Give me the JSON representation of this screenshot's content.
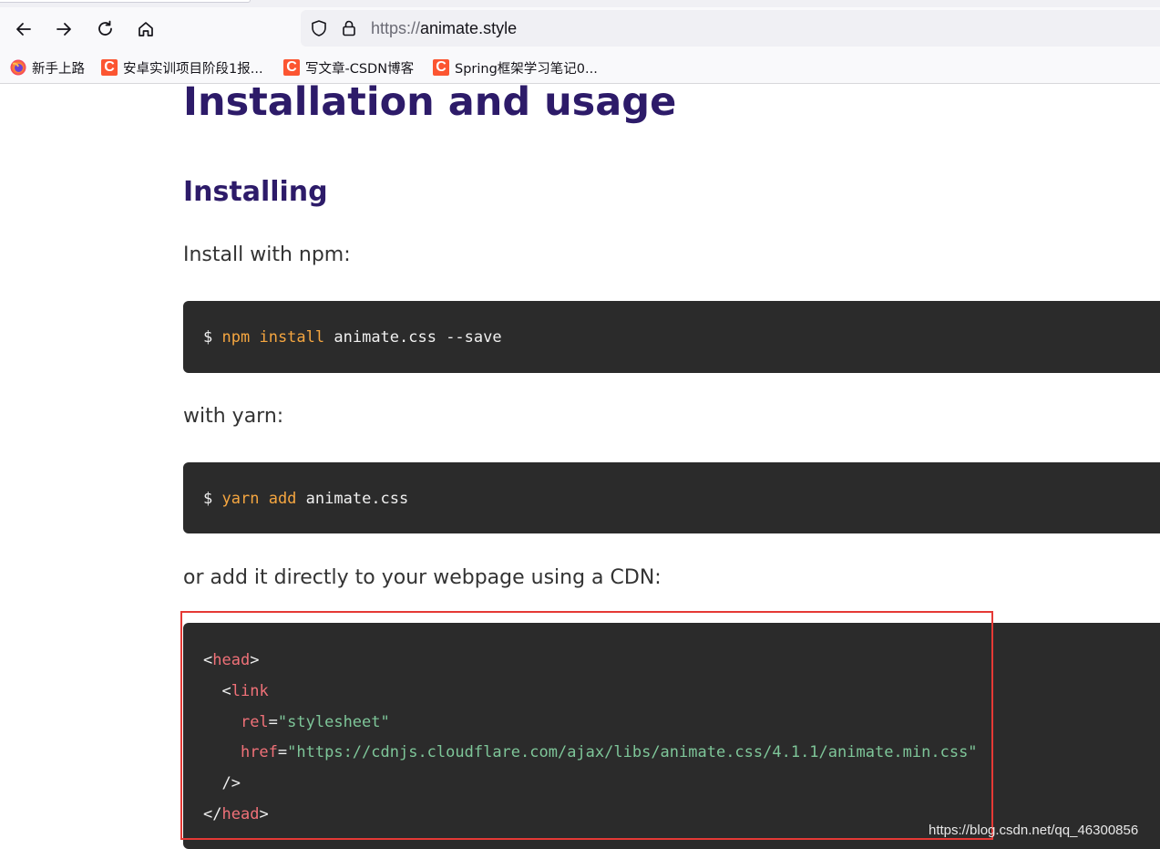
{
  "browser": {
    "url_protocol": "https://",
    "url_host": "animate.style"
  },
  "bookmarks": [
    {
      "label": "新手上路",
      "icon": "firefox-icon"
    },
    {
      "label": "安卓实训项目阶段1报...",
      "icon": "csdn-icon"
    },
    {
      "label": "写文章-CSDN博客",
      "icon": "csdn-icon"
    },
    {
      "label": "Spring框架学习笔记0...",
      "icon": "csdn-icon"
    }
  ],
  "page": {
    "title": "Installation and usage",
    "section": "Installing",
    "npm_intro": "Install with npm:",
    "npm_cmd": {
      "prompt": "$",
      "kw1": "npm",
      "kw2": "install",
      "rest": "animate.css --save"
    },
    "yarn_intro": "with yarn:",
    "yarn_cmd": {
      "prompt": "$",
      "kw1": "yarn",
      "kw2": "add",
      "rest": "animate.css"
    },
    "cdn_intro": "or add it directly to your webpage using a CDN:",
    "cdn": {
      "open_lt": "<",
      "head_tag": "head",
      "gt": ">",
      "link_lt": "<",
      "link_tag": "link",
      "rel_attr": "rel",
      "rel_val": "\"stylesheet\"",
      "href_attr": "href",
      "href_val": "\"https://cdnjs.cloudflare.com/ajax/libs/animate.css/4.1.1/animate.min.css\"",
      "eq": "=",
      "self_close": "/>",
      "close_lt": "</",
      "close_tag": "head"
    }
  },
  "watermark": "https://blog.csdn.net/qq_46300856",
  "colors": {
    "heading": "#2d1b69",
    "code_bg": "#2b2b2b",
    "highlight": "#e53935"
  }
}
